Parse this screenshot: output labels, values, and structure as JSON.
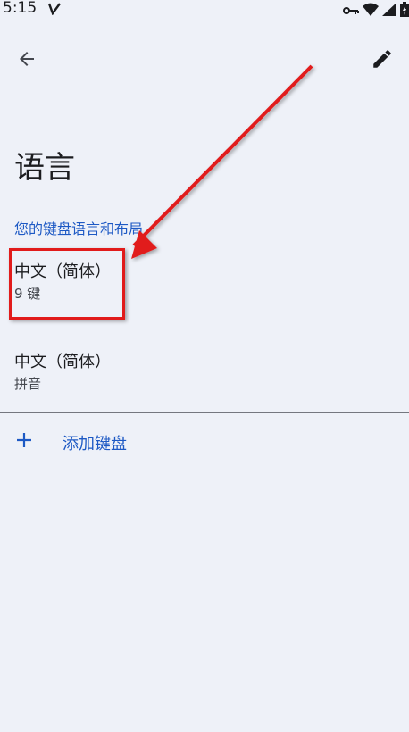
{
  "status_bar": {
    "time": "5:15"
  },
  "app_bar": {
    "back_icon": "arrow-back-icon",
    "edit_icon": "pencil-edit-icon"
  },
  "page": {
    "title": "语言",
    "section_header": "您的键盘语言和布局"
  },
  "keyboards": [
    {
      "title": "中文（简体）",
      "subtitle": "9 键"
    },
    {
      "title": "中文（简体）",
      "subtitle": "拼音"
    }
  ],
  "add_keyboard": {
    "label": "添加键盘",
    "icon": "plus-icon"
  },
  "colors": {
    "background": "#eef1f8",
    "accent": "#1d59c4",
    "annotation": "#e11b1b"
  }
}
